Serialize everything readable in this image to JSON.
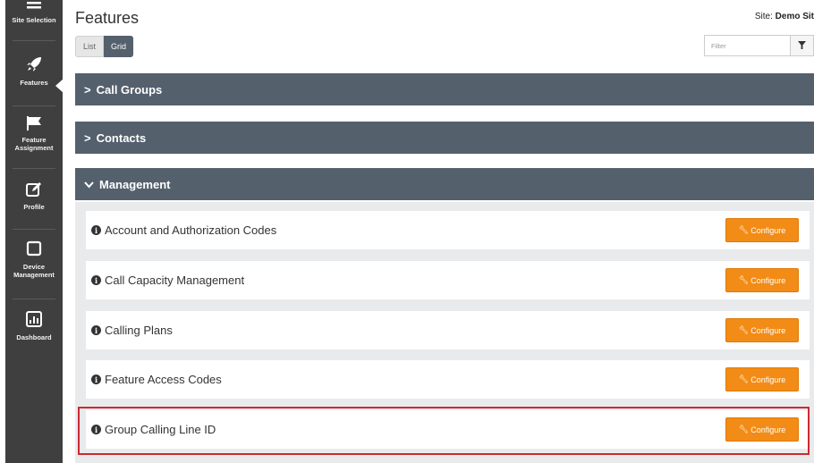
{
  "sidebar": {
    "items": [
      {
        "label": "Site Selection",
        "icon": "list-icon"
      },
      {
        "label": "Features",
        "icon": "rocket-icon",
        "active": true
      },
      {
        "label": "Feature\nAssignment",
        "icon": "flag-icon"
      },
      {
        "label": "Profile",
        "icon": "edit-icon"
      },
      {
        "label": "Device\nManagement",
        "icon": "device-icon"
      },
      {
        "label": "Dashboard",
        "icon": "chart-icon"
      }
    ]
  },
  "header": {
    "title": "Features",
    "site_prefix": "Site:",
    "site_name": "Demo Sit",
    "view_list": "List",
    "view_grid": "Grid",
    "filter_placeholder": "Filter"
  },
  "groups": [
    {
      "label": "Call Groups",
      "expanded": false
    },
    {
      "label": "Contacts",
      "expanded": false
    },
    {
      "label": "Management",
      "expanded": true
    }
  ],
  "management_items": [
    {
      "label": "Account and Authorization Codes",
      "action": "Configure"
    },
    {
      "label": "Call Capacity Management",
      "action": "Configure"
    },
    {
      "label": "Calling Plans",
      "action": "Configure"
    },
    {
      "label": "Feature Access Codes",
      "action": "Configure"
    },
    {
      "label": "Group Calling Line ID",
      "action": "Configure",
      "highlighted": true
    }
  ],
  "colors": {
    "sidebar": "#3f3f3f",
    "group_bar": "#55606d",
    "configure": "#f28c16",
    "highlight": "#cc2a34"
  }
}
